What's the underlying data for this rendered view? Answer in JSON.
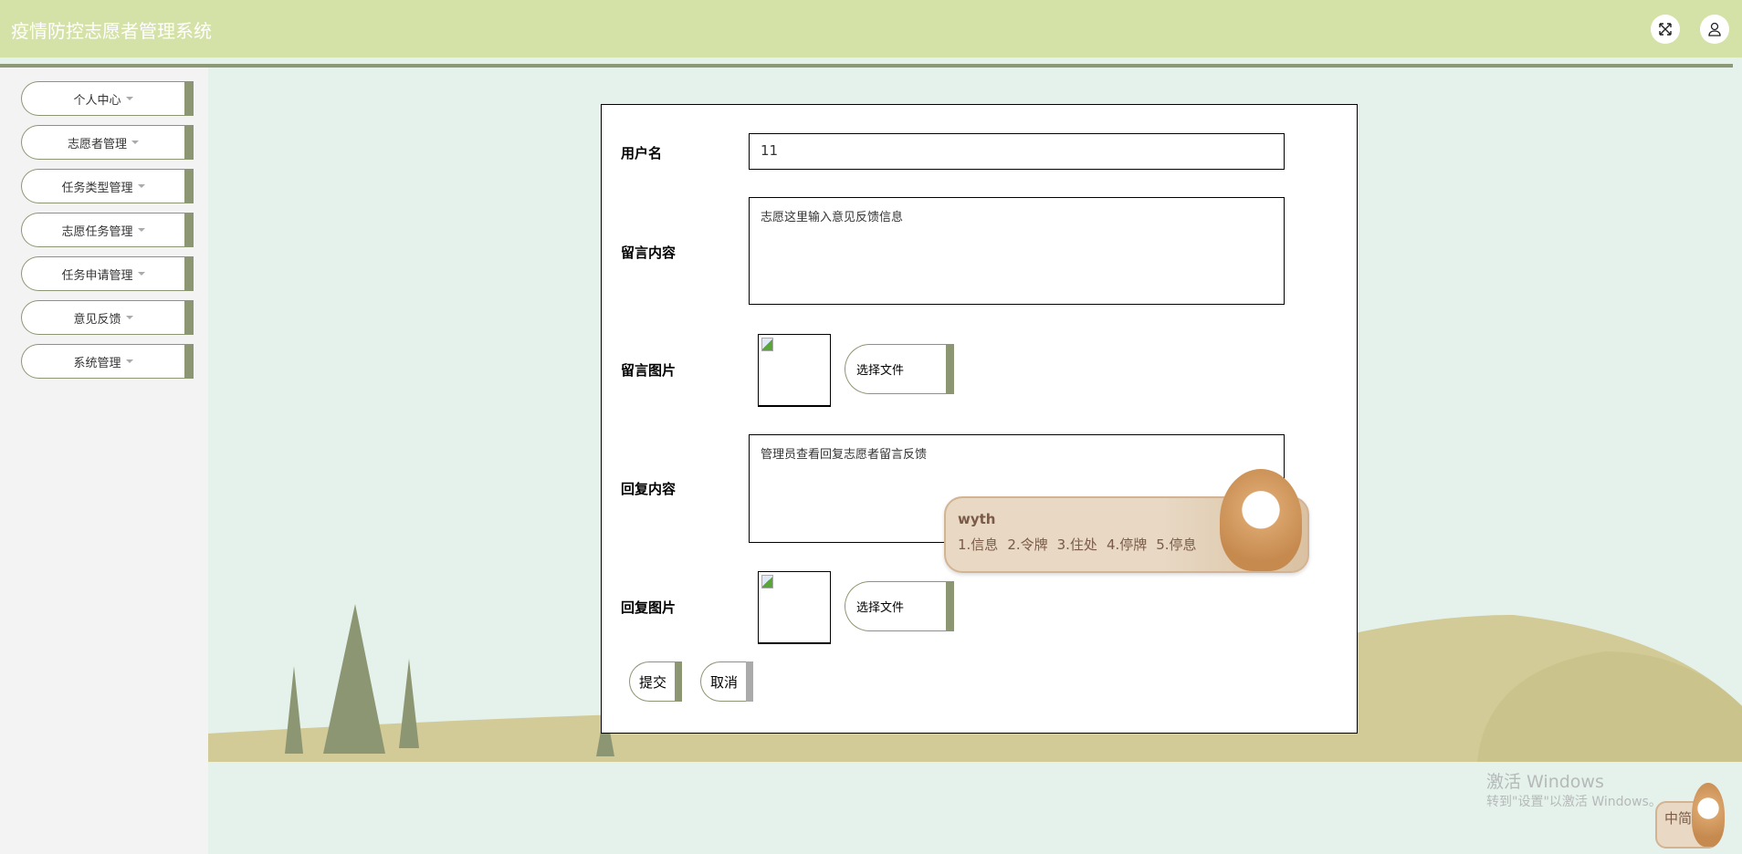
{
  "header": {
    "title": "疫情防控志愿者管理系统",
    "icons": [
      "fullscreen-icon",
      "user-icon"
    ]
  },
  "sidebar": {
    "items": [
      {
        "label": "个人中心"
      },
      {
        "label": "志愿者管理"
      },
      {
        "label": "任务类型管理"
      },
      {
        "label": "志愿任务管理"
      },
      {
        "label": "任务申请管理"
      },
      {
        "label": "意见反馈"
      },
      {
        "label": "系统管理"
      }
    ]
  },
  "form": {
    "username_label": "用户名",
    "username_value": "11",
    "message_label": "留言内容",
    "message_value": "志愿这里输入意见反馈信息",
    "message_image_label": "留言图片",
    "choose_file": "选择文件",
    "reply_label": "回复内容",
    "reply_value": "管理员查看回复志愿者留言反馈",
    "reply_image_label": "回复图片",
    "submit": "提交",
    "cancel": "取消"
  },
  "ime": {
    "composition": "wyth",
    "candidates": [
      "1.信息",
      "2.令牌",
      "3.住处",
      "4.停牌",
      "5.停息"
    ],
    "status": "中简"
  },
  "watermark": {
    "line1": "激活 Windows",
    "line2": "转到\"设置\"以激活 Windows。"
  },
  "colors": {
    "header": "#d4e2a8",
    "accent": "#8d9673",
    "background": "#e5f2ec",
    "ground": "#d3cb97"
  }
}
